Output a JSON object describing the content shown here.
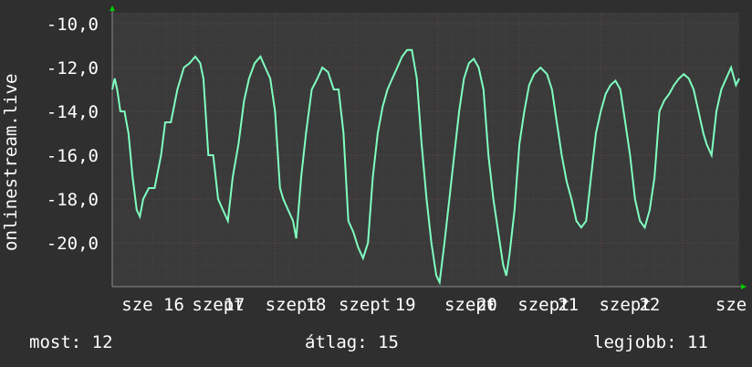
{
  "chart_data": {
    "type": "line",
    "ylabel": "onlinestream.live",
    "ylim": [
      -22,
      -9.5
    ],
    "yticks": [
      {
        "value": -10,
        "label": "-10,0"
      },
      {
        "value": -12,
        "label": "-12,0"
      },
      {
        "value": -14,
        "label": "-14,0"
      },
      {
        "value": -16,
        "label": "-16,0"
      },
      {
        "value": -18,
        "label": "-18,0"
      },
      {
        "value": -20,
        "label": "-20,0"
      }
    ],
    "x": {
      "start_day": 15.0,
      "end_day": 22.7
    },
    "xticks": [
      {
        "value": 15.5,
        "label": "sze 16"
      },
      {
        "value": 16.3,
        "label": "szept"
      },
      {
        "value": 16.5,
        "label": "17"
      },
      {
        "value": 17.2,
        "label": "szept"
      },
      {
        "value": 17.5,
        "label": "18"
      },
      {
        "value": 18.1,
        "label": "szept"
      },
      {
        "value": 18.6,
        "label": "19"
      },
      {
        "value": 19.4,
        "label": "szept"
      },
      {
        "value": 19.6,
        "label": "20"
      },
      {
        "value": 20.3,
        "label": "szept"
      },
      {
        "value": 20.6,
        "label": "21"
      },
      {
        "value": 21.3,
        "label": "szept"
      },
      {
        "value": 21.6,
        "label": "22"
      },
      {
        "value": 22.6,
        "label": "sze"
      }
    ],
    "series": [
      {
        "name": "",
        "color": "#7fffc0",
        "points": [
          [
            15.0,
            -13.0
          ],
          [
            15.03,
            -12.5
          ],
          [
            15.06,
            -13.0
          ],
          [
            15.1,
            -14.0
          ],
          [
            15.15,
            -14.0
          ],
          [
            15.2,
            -15.0
          ],
          [
            15.25,
            -17.0
          ],
          [
            15.3,
            -18.5
          ],
          [
            15.34,
            -18.8
          ],
          [
            15.38,
            -18.0
          ],
          [
            15.45,
            -17.5
          ],
          [
            15.52,
            -17.5
          ],
          [
            15.6,
            -16.0
          ],
          [
            15.65,
            -14.5
          ],
          [
            15.72,
            -14.5
          ],
          [
            15.8,
            -13.0
          ],
          [
            15.88,
            -12.0
          ],
          [
            15.95,
            -11.8
          ],
          [
            16.02,
            -11.5
          ],
          [
            16.08,
            -11.8
          ],
          [
            16.12,
            -12.5
          ],
          [
            16.18,
            -16.0
          ],
          [
            16.24,
            -16.0
          ],
          [
            16.3,
            -18.0
          ],
          [
            16.36,
            -18.5
          ],
          [
            16.42,
            -19.0
          ],
          [
            16.48,
            -17.0
          ],
          [
            16.55,
            -15.5
          ],
          [
            16.62,
            -13.5
          ],
          [
            16.68,
            -12.5
          ],
          [
            16.75,
            -11.8
          ],
          [
            16.82,
            -11.5
          ],
          [
            16.88,
            -12.0
          ],
          [
            16.94,
            -12.5
          ],
          [
            17.0,
            -14.0
          ],
          [
            17.06,
            -17.5
          ],
          [
            17.1,
            -18.0
          ],
          [
            17.16,
            -18.5
          ],
          [
            17.22,
            -19.0
          ],
          [
            17.26,
            -19.8
          ],
          [
            17.32,
            -17.0
          ],
          [
            17.38,
            -15.0
          ],
          [
            17.45,
            -13.0
          ],
          [
            17.52,
            -12.5
          ],
          [
            17.58,
            -12.0
          ],
          [
            17.65,
            -12.2
          ],
          [
            17.72,
            -13.0
          ],
          [
            17.78,
            -13.0
          ],
          [
            17.84,
            -15.0
          ],
          [
            17.9,
            -19.0
          ],
          [
            17.96,
            -19.5
          ],
          [
            18.02,
            -20.2
          ],
          [
            18.08,
            -20.7
          ],
          [
            18.14,
            -20.0
          ],
          [
            18.2,
            -17.0
          ],
          [
            18.26,
            -15.0
          ],
          [
            18.32,
            -13.8
          ],
          [
            18.38,
            -13.0
          ],
          [
            18.44,
            -12.5
          ],
          [
            18.5,
            -12.0
          ],
          [
            18.56,
            -11.5
          ],
          [
            18.62,
            -11.2
          ],
          [
            18.68,
            -11.2
          ],
          [
            18.74,
            -12.5
          ],
          [
            18.8,
            -15.5
          ],
          [
            18.86,
            -18.0
          ],
          [
            18.92,
            -20.0
          ],
          [
            18.98,
            -21.5
          ],
          [
            19.02,
            -21.8
          ],
          [
            19.08,
            -20.0
          ],
          [
            19.14,
            -18.0
          ],
          [
            19.2,
            -16.0
          ],
          [
            19.26,
            -14.0
          ],
          [
            19.32,
            -12.5
          ],
          [
            19.38,
            -11.8
          ],
          [
            19.44,
            -11.6
          ],
          [
            19.5,
            -12.0
          ],
          [
            19.56,
            -13.0
          ],
          [
            19.62,
            -16.0
          ],
          [
            19.68,
            -18.0
          ],
          [
            19.74,
            -19.5
          ],
          [
            19.8,
            -21.0
          ],
          [
            19.84,
            -21.5
          ],
          [
            19.88,
            -20.5
          ],
          [
            19.94,
            -18.5
          ],
          [
            20.0,
            -15.5
          ],
          [
            20.06,
            -14.0
          ],
          [
            20.12,
            -12.8
          ],
          [
            20.18,
            -12.3
          ],
          [
            20.26,
            -12.0
          ],
          [
            20.34,
            -12.3
          ],
          [
            20.4,
            -13.0
          ],
          [
            20.46,
            -14.5
          ],
          [
            20.52,
            -16.0
          ],
          [
            20.58,
            -17.2
          ],
          [
            20.64,
            -18.0
          ],
          [
            20.7,
            -19.0
          ],
          [
            20.76,
            -19.3
          ],
          [
            20.82,
            -19.0
          ],
          [
            20.88,
            -17.0
          ],
          [
            20.94,
            -15.0
          ],
          [
            21.0,
            -14.0
          ],
          [
            21.06,
            -13.2
          ],
          [
            21.12,
            -12.8
          ],
          [
            21.18,
            -12.6
          ],
          [
            21.24,
            -13.0
          ],
          [
            21.3,
            -14.5
          ],
          [
            21.36,
            -16.0
          ],
          [
            21.42,
            -18.0
          ],
          [
            21.48,
            -19.0
          ],
          [
            21.54,
            -19.3
          ],
          [
            21.6,
            -18.5
          ],
          [
            21.66,
            -17.0
          ],
          [
            21.72,
            -14.0
          ],
          [
            21.78,
            -13.5
          ],
          [
            21.84,
            -13.2
          ],
          [
            21.9,
            -12.8
          ],
          [
            21.96,
            -12.5
          ],
          [
            22.02,
            -12.3
          ],
          [
            22.08,
            -12.5
          ],
          [
            22.14,
            -13.0
          ],
          [
            22.2,
            -14.0
          ],
          [
            22.26,
            -15.0
          ],
          [
            22.3,
            -15.5
          ],
          [
            22.36,
            -16.0
          ],
          [
            22.42,
            -14.0
          ],
          [
            22.48,
            -13.0
          ],
          [
            22.54,
            -12.5
          ],
          [
            22.6,
            -12.0
          ],
          [
            22.66,
            -12.8
          ],
          [
            22.7,
            -12.5
          ]
        ]
      }
    ]
  },
  "footer": {
    "current": "most: 12",
    "average": "átlag: 15",
    "best": "legjobb: 11"
  },
  "colors": {
    "background": "#2f2f2f",
    "plot_background": "#3a3a3a",
    "grid_minor": "#5a4a4a",
    "grid_major": "#6a4a4a",
    "line": "#7fffc0",
    "axis_arrow": "#00cc00"
  }
}
